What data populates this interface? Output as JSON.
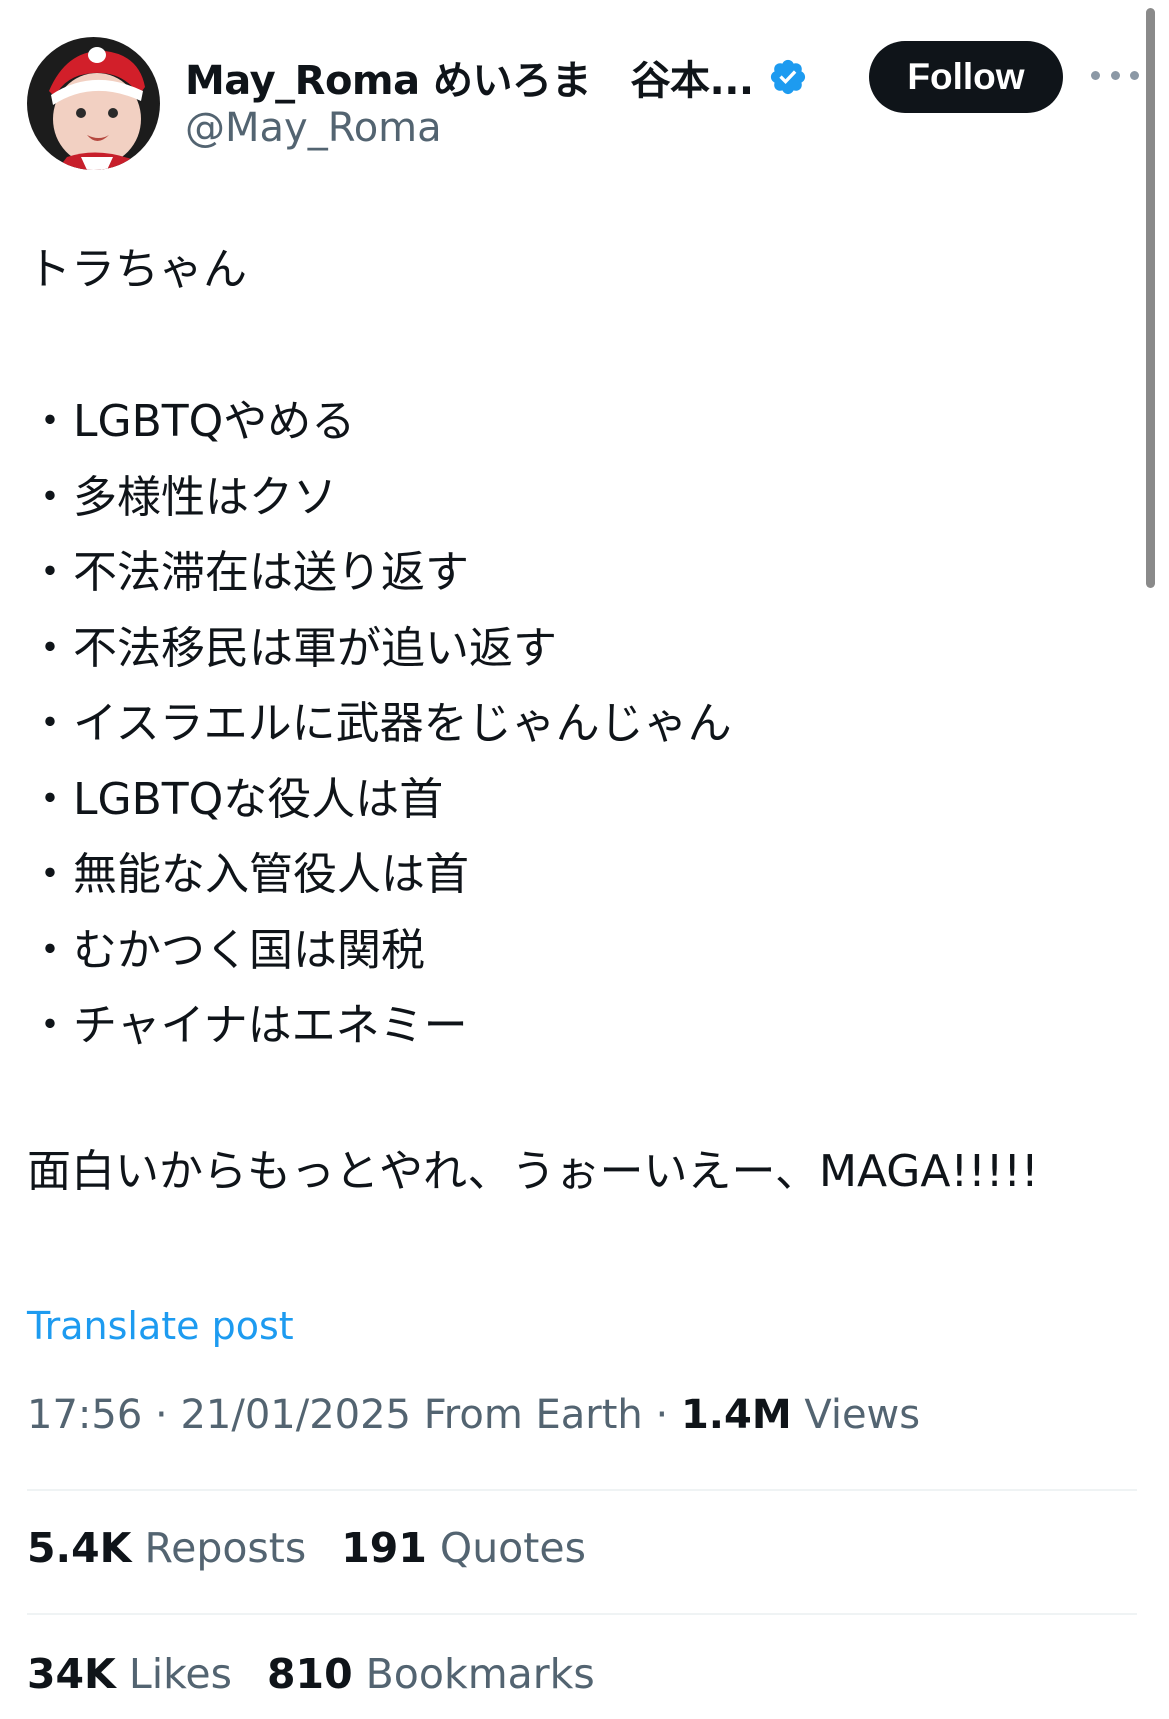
{
  "author": {
    "display_name": "May_Roma めいろま　谷本...",
    "handle": "@May_Roma"
  },
  "follow_button": {
    "label": "Follow"
  },
  "tweet": {
    "intro": "トラちゃん",
    "bullet_glyph": "・",
    "bullets": [
      "LGBTQやめる",
      "多様性はクソ",
      "不法滞在は送り返す",
      "不法移民は軍が追い返す",
      "イスラエルに武器をじゃんじゃん",
      "LGBTQな役人は首",
      "無能な入管役人は首",
      "むかつく国は関税",
      "チャイナはエネミー"
    ],
    "closing": "面白いからもっとやれ、うぉーいえー、MAGA!!!!!"
  },
  "translate": {
    "label": "Translate post"
  },
  "meta": {
    "time": "17:56",
    "separator": "·",
    "date": "21/01/2025",
    "source": "From Earth",
    "views_count": "1.4M",
    "views_label": "Views"
  },
  "stats": {
    "reposts_count": "5.4K",
    "reposts_label": "Reposts",
    "quotes_count": "191",
    "quotes_label": "Quotes",
    "likes_count": "34K",
    "likes_label": "Likes",
    "bookmarks_count": "810",
    "bookmarks_label": "Bookmarks"
  },
  "icons": {
    "verified": "verified-badge-icon",
    "more": "more-options-icon"
  },
  "colors": {
    "link": "#1d9bf0",
    "verified": "#1d9bf0",
    "text": "#0f1419",
    "secondary": "#536471",
    "button_bg": "#0f1419"
  }
}
